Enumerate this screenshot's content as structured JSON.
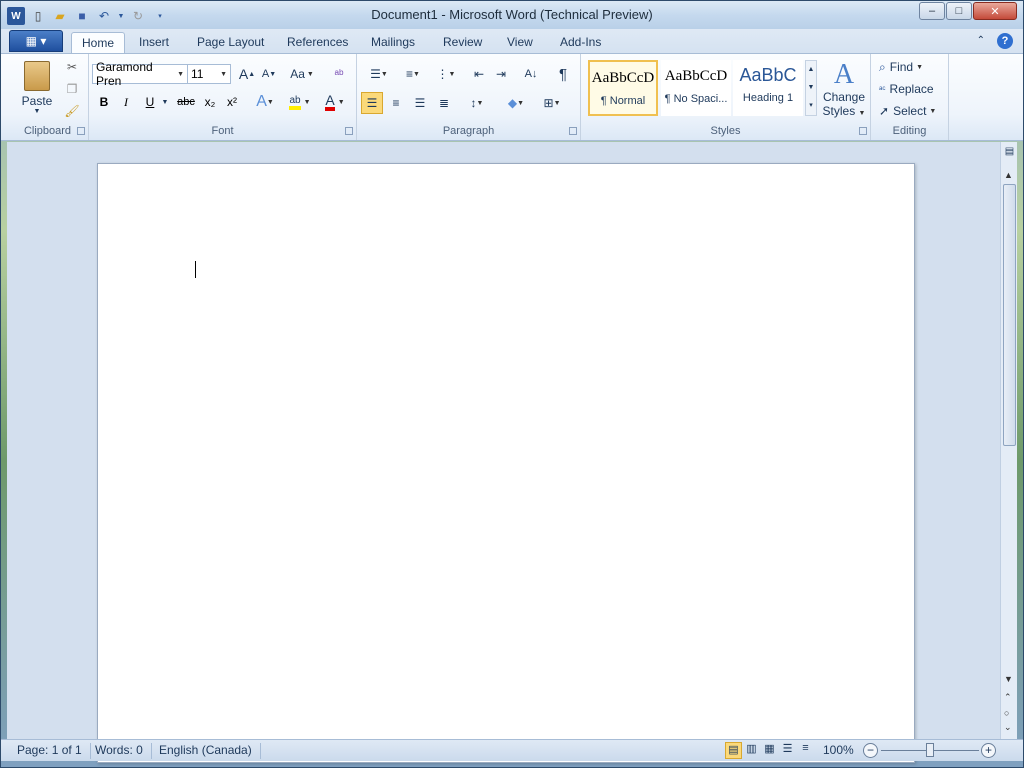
{
  "window": {
    "title": "Document1  -  Microsoft Word (Technical Preview)",
    "controls": {
      "minimize": "–",
      "maximize": "□",
      "close": "✕"
    }
  },
  "qat": [
    "word-app-icon",
    "new-icon",
    "open-icon",
    "save-icon",
    "undo-icon",
    "redo-icon",
    "customize-icon"
  ],
  "tabs": [
    {
      "label": "Home",
      "active": true
    },
    {
      "label": "Insert"
    },
    {
      "label": "Page Layout"
    },
    {
      "label": "References"
    },
    {
      "label": "Mailings"
    },
    {
      "label": "Review"
    },
    {
      "label": "View"
    },
    {
      "label": "Add-Ins"
    }
  ],
  "ribbon": {
    "clipboard": {
      "label": "Clipboard",
      "paste": "Paste"
    },
    "font": {
      "label": "Font",
      "font_name": "Garamond Pren",
      "font_size": "11",
      "bold": "B",
      "italic": "I",
      "underline": "U",
      "strike": "abc",
      "subscript": "x₂",
      "superscript": "x²",
      "grow": "A",
      "shrink": "A",
      "change_case": "Aa",
      "highlight": "ab",
      "font_color": "A"
    },
    "paragraph": {
      "label": "Paragraph",
      "pilcrow": "¶"
    },
    "styles": {
      "label": "Styles",
      "items": [
        {
          "sample": "AaBbCcD",
          "name": "¶ Normal",
          "selected": true
        },
        {
          "sample": "AaBbCcD",
          "name": "¶ No Spaci..."
        },
        {
          "sample": "AaBbC",
          "name": "Heading 1"
        }
      ],
      "change_styles_line1": "Change",
      "change_styles_line2": "Styles"
    },
    "editing": {
      "label": "Editing",
      "find": "Find",
      "replace": "Replace",
      "select": "Select"
    }
  },
  "status": {
    "page": "Page: 1 of 1",
    "words": "Words: 0",
    "language": "English (Canada)",
    "zoom": "100%",
    "zoom_level": 100
  }
}
